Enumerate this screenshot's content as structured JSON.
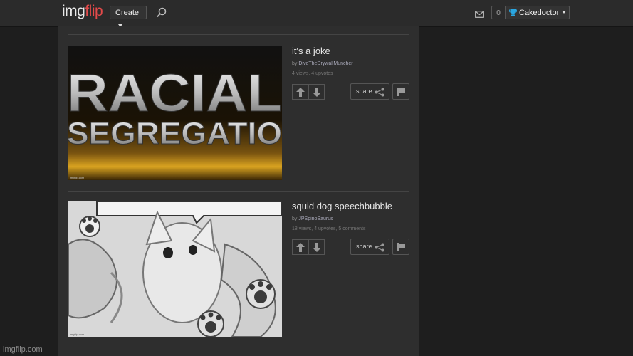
{
  "header": {
    "logo_part1": "img",
    "logo_part2": "flip",
    "create_label": "Create",
    "notification_count": "0",
    "username": "Cakedoctor"
  },
  "posts": [
    {
      "title": "it's a joke",
      "by_prefix": "by",
      "author": "DiveTheDrywallMuncher",
      "stats": "4 views, 4 upvotes",
      "share_label": "share",
      "image_text_1": "RACIAL",
      "image_text_2": "SEGREGATIO",
      "image_watermark": "imgflip.com"
    },
    {
      "title": "squid dog speechbubble",
      "by_prefix": "by",
      "author": "JPSpinoSaurus",
      "stats": "18 views, 4 upvotes, 5 comments",
      "share_label": "share",
      "image_watermark": "imgflip.com"
    }
  ],
  "footer": {
    "watermark": "imgflip.com"
  },
  "colors": {
    "logo_accent": "#e34a4a",
    "trophy": "#2aa6e0",
    "background": "#1e1e1e",
    "panel": "#2e2e2e"
  }
}
